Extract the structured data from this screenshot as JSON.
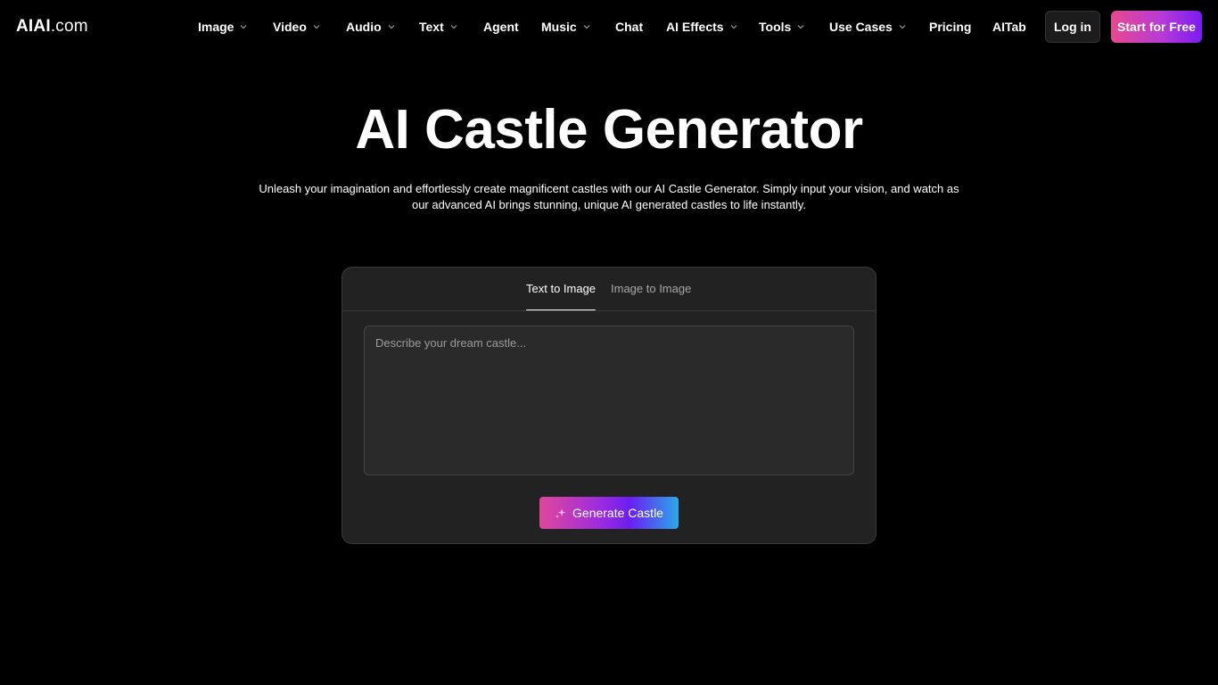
{
  "header": {
    "logo_brand": "AIAI",
    "logo_tld": ".com",
    "nav": [
      {
        "label": "Image",
        "has_dropdown": true
      },
      {
        "label": "Video",
        "has_dropdown": true
      },
      {
        "label": "Audio",
        "has_dropdown": true
      },
      {
        "label": "Text",
        "has_dropdown": true
      },
      {
        "label": "Agent",
        "has_dropdown": false
      },
      {
        "label": "Music",
        "has_dropdown": true
      },
      {
        "label": "Chat",
        "has_dropdown": false
      },
      {
        "label": "AI Effects",
        "has_dropdown": true
      },
      {
        "label": "Tools",
        "has_dropdown": true
      },
      {
        "label": "Use Cases",
        "has_dropdown": true
      },
      {
        "label": "Pricing",
        "has_dropdown": false
      },
      {
        "label": "AITab",
        "has_dropdown": false
      }
    ],
    "login_label": "Log in",
    "start_label": "Start for Free"
  },
  "hero": {
    "title": "AI Castle Generator",
    "description": "Unleash your imagination and effortlessly create magnificent castles with our AI Castle Generator. Simply input your vision, and watch as our advanced AI brings stunning, unique AI generated castles to life instantly."
  },
  "generator": {
    "tabs": [
      {
        "label": "Text to Image",
        "active": true
      },
      {
        "label": "Image to Image",
        "active": false
      }
    ],
    "prompt_placeholder": "Describe your dream castle...",
    "prompt_value": "",
    "generate_label": "Generate Castle",
    "generate_icon": "sparkle-icon"
  },
  "colors": {
    "background": "#000000",
    "card": "#222222",
    "accent_pink": "#e8488f",
    "accent_purple": "#7a1cf0",
    "accent_blue": "#2aa9ea"
  }
}
